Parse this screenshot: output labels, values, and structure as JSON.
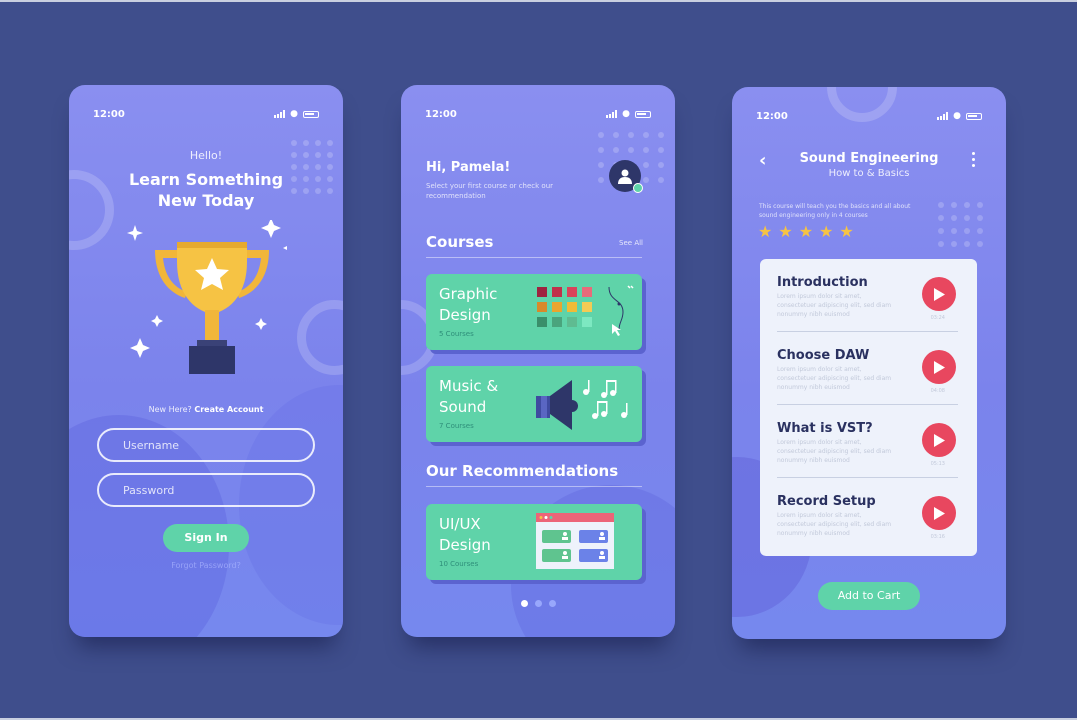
{
  "status_bar": {
    "time": "12:00"
  },
  "login_screen": {
    "greeting": "Hello!",
    "headline_line1": "Learn Something",
    "headline_line2": "New Today",
    "new_here": "New Here?",
    "create_account": "Create Account",
    "username_placeholder": "Username",
    "password_placeholder": "Password",
    "sign_in_label": "Sign In",
    "forgot_password": "Forgot Password?"
  },
  "home_screen": {
    "greeting": "Hi, Pamela!",
    "subtitle": "Select your first course or check our recommendation",
    "courses_title": "Courses",
    "see_all": "See All",
    "courses": [
      {
        "line1": "Graphic",
        "line2": "Design",
        "count": "5 Courses"
      },
      {
        "line1": "Music &",
        "line2": "Sound",
        "count": "7 Courses"
      }
    ],
    "recommendations_title": "Our Recommendations",
    "recommendations": [
      {
        "line1": "UI/UX",
        "line2": "Design",
        "count": "10 Courses"
      }
    ],
    "pager": {
      "pages": 3,
      "active": 1
    },
    "palette_colors": [
      "#9e2340",
      "#c0304a",
      "#d9435a",
      "#e96a7a",
      "#d88a2a",
      "#e9a52e",
      "#f0bb37",
      "#f3cb55",
      "#3a8f6b",
      "#4aa47d",
      "#5fbb91",
      "#7de8c1"
    ]
  },
  "course_screen": {
    "back_icon": "chevron-left-icon",
    "title": "Sound Engineering",
    "subtitle": "How to & Basics",
    "description": "This course will teach you the basics and all about sound engineering only in 4 courses",
    "rating": 5,
    "rating_max": 5,
    "lessons": [
      {
        "title": "Introduction",
        "desc": "Lorem ipsum dolor sit amet, consectetuer adipiscing elit, sed diam nonummy nibh euismod",
        "duration": "03:24"
      },
      {
        "title": "Choose DAW",
        "desc": "Lorem ipsum dolor sit amet, consectetuer adipiscing elit, sed diam nonummy nibh euismod",
        "duration": "04:08"
      },
      {
        "title": "What is VST?",
        "desc": "Lorem ipsum dolor sit amet, consectetuer adipiscing elit, sed diam nonummy nibh euismod",
        "duration": "05:13"
      },
      {
        "title": "Record Setup",
        "desc": "Lorem ipsum dolor sit amet, consectetuer adipiscing elit, sed diam nonummy nibh euismod",
        "duration": "03:16"
      }
    ],
    "add_to_cart_label": "Add to Cart"
  },
  "colors": {
    "background": "#3f4e8c",
    "accent_green": "#5fd3a9",
    "play_red": "#e8475f",
    "trophy_gold": "#f6c344",
    "dark_navy": "#2e3669"
  }
}
